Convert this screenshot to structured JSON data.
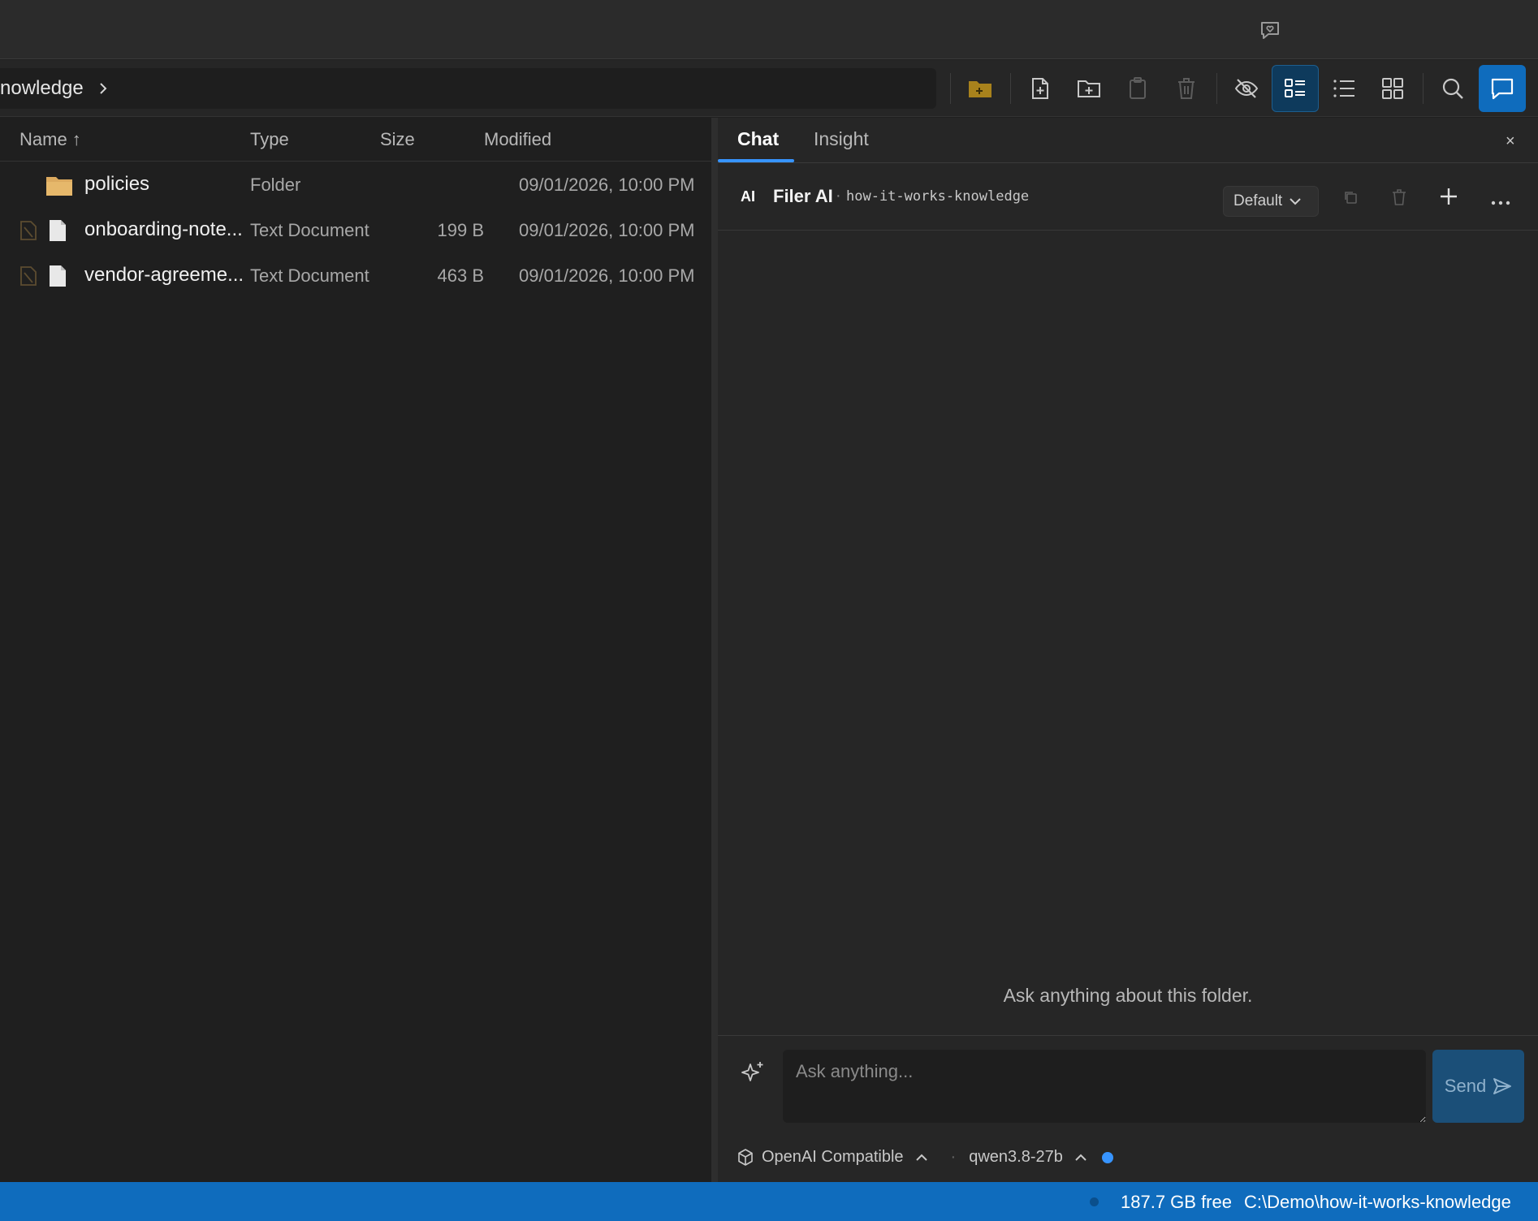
{
  "titlebar": {
    "feedback_icon": "heart-message-icon"
  },
  "toolbar": {
    "breadcrumb": "nowledge",
    "buttons": [
      {
        "name": "open-folder-button",
        "icon": "folder-icon"
      },
      {
        "name": "new-file-button",
        "icon": "file-plus-icon"
      },
      {
        "name": "new-folder-button",
        "icon": "folder-plus-icon"
      },
      {
        "name": "paste-button",
        "icon": "clipboard-icon"
      },
      {
        "name": "delete-button",
        "icon": "trash-icon"
      },
      {
        "name": "hidden-files-toggle",
        "icon": "eye-off-icon"
      },
      {
        "name": "details-view-button",
        "icon": "details-view-icon"
      },
      {
        "name": "list-view-button",
        "icon": "list-view-icon"
      },
      {
        "name": "grid-view-button",
        "icon": "grid-view-icon"
      },
      {
        "name": "search-button",
        "icon": "search-icon"
      },
      {
        "name": "chat-toggle-button",
        "icon": "chat-icon"
      }
    ]
  },
  "file_list": {
    "columns": {
      "name": "Name ↑",
      "type": "Type",
      "size": "Size",
      "modified": "Modified"
    },
    "rows": [
      {
        "name": "policies",
        "type": "Folder",
        "size": "",
        "modified": "09/01/2026, 10:00 PM",
        "kind": "folder"
      },
      {
        "name": "onboarding-note...",
        "type": "Text Document",
        "size": "199 B",
        "modified": "09/01/2026, 10:00 PM",
        "kind": "file"
      },
      {
        "name": "vendor-agreeme...",
        "type": "Text Document",
        "size": "463 B",
        "modified": "09/01/2026, 10:00 PM",
        "kind": "file"
      }
    ]
  },
  "chat_panel": {
    "tabs": [
      {
        "label": "Chat",
        "active": true
      },
      {
        "label": "Insight",
        "active": false
      }
    ],
    "close_label": "×",
    "header": {
      "badge": "AI",
      "name": "Filer AI",
      "separator": "·",
      "folder": "how-it-works-knowledge",
      "mode": "Default"
    },
    "empty_message": "Ask anything about this folder.",
    "composer": {
      "placeholder": "Ask anything...",
      "send_label": "Send"
    },
    "provider": {
      "name": "OpenAI Compatible",
      "separator": "·",
      "model": "qwen3.8-27b"
    }
  },
  "statusbar": {
    "free_space": "187.7 GB free",
    "path": "C:\\Demo\\how-it-works-knowledge"
  },
  "colors": {
    "accent": "#0f6cbd",
    "tab_underline": "#3794ff",
    "folder": "#dcaa5f"
  }
}
